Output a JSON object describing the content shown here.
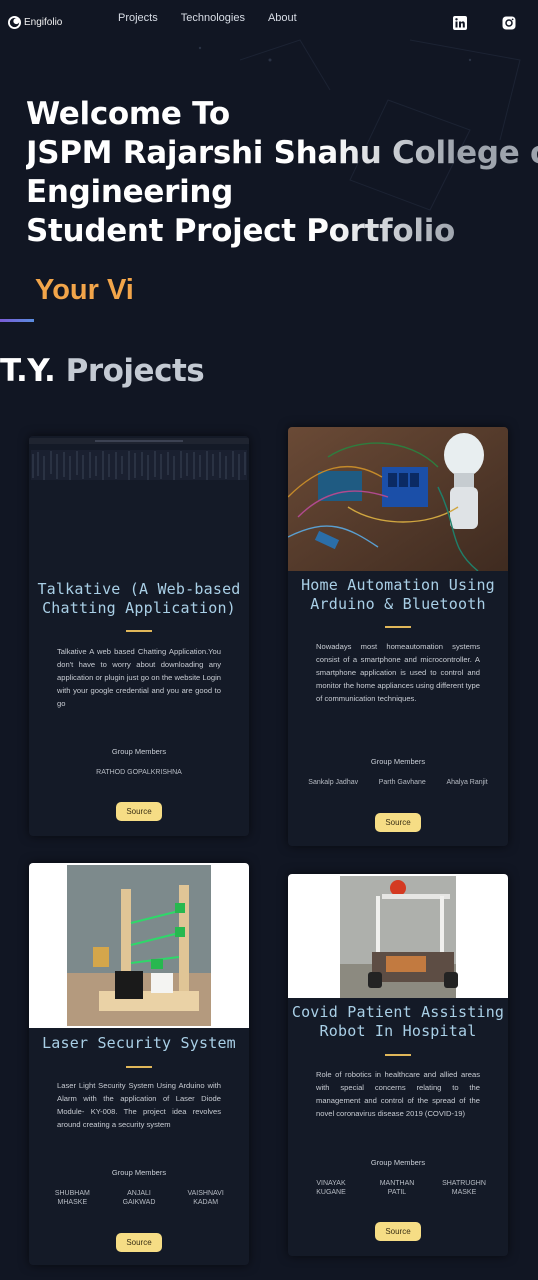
{
  "nav": {
    "logo_text": "Engifolio",
    "links": [
      "Projects",
      "Technologies",
      "About"
    ],
    "social_icons": [
      "linkedin-icon",
      "instagram-icon"
    ]
  },
  "hero": {
    "line1": "Welcome To",
    "line2": "JSPM Rajarshi Shahu College of",
    "line3": "Engineering",
    "line4": "Student Project Portfolio",
    "typing_text": "Your Vi"
  },
  "section": {
    "title_prefix": "T.Y.",
    "title_suffix": "Projects"
  },
  "projects": [
    {
      "title": "Talkative (A Web-based Chatting Application)",
      "description": "Talkative A web based Chatting Application.You don't have to worry about downloading any application or plugin just go on the website Login with your google credential and you are good to go",
      "members_label": "Group Members",
      "members": [
        "RATHOD GOPALKRISHNA"
      ],
      "source_label": "Source"
    },
    {
      "title": "Home Automation Using Arduino & Bluetooth",
      "description": "Nowadays most homeautomation systems consist of a smartphone and microcontroller. A smartphone application is used to control and monitor the home appliances using different type of communication techniques.",
      "members_label": "Group Members",
      "members": [
        "Sankalp Jadhav",
        "Parth Gavhane",
        "Ahalya Ranjit"
      ],
      "source_label": "Source"
    },
    {
      "title": "Laser Security System",
      "description": "Laser Light Security System Using Arduino with Alarm with the application of Laser Diode Module- KY-008. The project idea revolves around creating a security system",
      "members_label": "Group Members",
      "members": [
        "SHUBHAM MHASKE",
        "ANJALI GAIKWAD",
        "VAISHNAVI KADAM"
      ],
      "source_label": "Source"
    },
    {
      "title": "Covid Patient Assisting Robot In Hospital",
      "description": "Role of robotics in healthcare and allied areas with special concerns relating to the management and control of the spread of the novel coronavirus disease 2019 (COVID-19)",
      "members_label": "Group Members",
      "members": [
        "VINAYAK KUGANE",
        "MANTHAN PATIL",
        "SHATRUGHN MASKE"
      ],
      "source_label": "Source"
    }
  ],
  "colors": {
    "background": "#111623",
    "card": "#141a27",
    "accent_orange": "#f2a54a",
    "title_blue": "#a9cfe6",
    "divider_gold": "#e0b75a",
    "button_yellow": "#f6dd85"
  }
}
